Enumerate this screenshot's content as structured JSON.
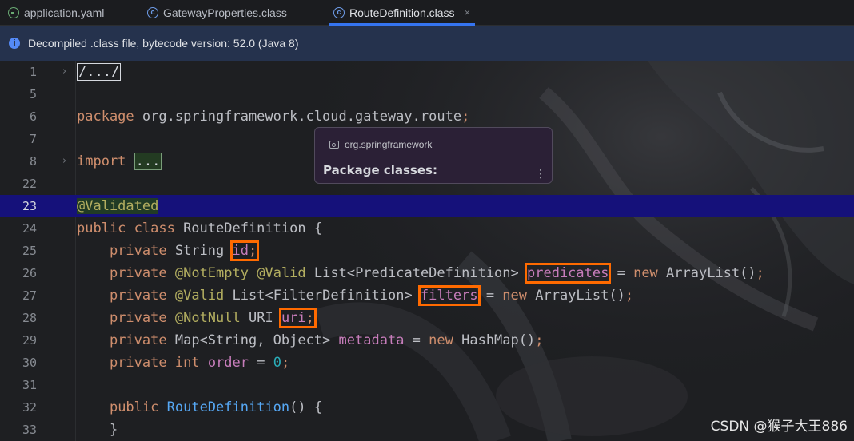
{
  "tabs": [
    {
      "label": "application.yaml",
      "icon": "yaml-file-icon"
    },
    {
      "label": "GatewayProperties.class",
      "icon": "class-file-icon"
    },
    {
      "label": "RouteDefinition.class",
      "icon": "class-file-icon",
      "close": "×"
    }
  ],
  "banner": {
    "icon": "i",
    "text": "Decompiled .class file, bytecode version: 52.0 (Java 8)"
  },
  "gutter": {
    "lines": [
      "1",
      "5",
      "6",
      "7",
      "8",
      "22",
      "23",
      "24",
      "25",
      "26",
      "27",
      "28",
      "29",
      "30",
      "31",
      "32",
      "33"
    ],
    "fold": "›"
  },
  "code": {
    "l1": "/.../",
    "l6_kw": "package",
    "l6_pkg": " org.springframework.cloud.gateway.route",
    "l6_semi": ";",
    "l8_kw": "import",
    "l8_dots": "...",
    "l23": "@Validated",
    "l24_kw": "public class",
    "l24_name": " RouteDefinition {",
    "indent": "    ",
    "private": "private",
    "l25_type": " String ",
    "l25_field": "id",
    "semi": ";",
    "l26_an1": "@NotEmpty",
    "l26_an2": "@Valid",
    "l26_type": " List<PredicateDefinition> ",
    "l26_field": "predicates",
    "eq": " = ",
    "new": "new",
    "l26_ctor": " ArrayList()",
    "l27_an": "@Valid",
    "l27_type": " List<FilterDefinition> ",
    "l27_field": "filters",
    "l27_ctor": " ArrayList()",
    "l28_an": "@NotNull",
    "l28_type": " URI ",
    "l28_field": "uri",
    "l29_type": " Map<String, Object> ",
    "l29_field": "metadata",
    "l29_ctor": " HashMap()",
    "l30_int": "int",
    "l30_field": "order",
    "l30_val": "0",
    "l32_kw": "public",
    "l32_fn": "RouteDefinition",
    "l32_rest": "() {",
    "l33": "}"
  },
  "popup": {
    "package": "org.springframework",
    "title": "Package classes:",
    "more": "⋮"
  },
  "watermark": "CSDN @猴子大王886",
  "colors": {
    "highlight_row": "#15117a",
    "marker": "#ff6a00",
    "keyword": "#cf8e6d",
    "annotation": "#b3ae60",
    "field": "#c77dbb",
    "number": "#2aacb8",
    "function": "#56a8f5",
    "banner": "#25324d"
  }
}
